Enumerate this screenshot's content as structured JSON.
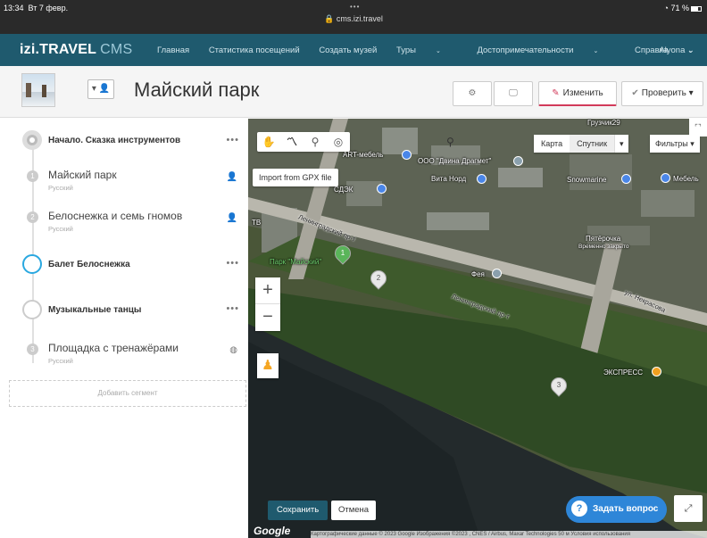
{
  "status": {
    "time": "13:34",
    "date": "Вт 7 февр.",
    "dots": "•••",
    "url": "cms.izi.travel",
    "battery": "71 %"
  },
  "nav": {
    "logo": "izi.TRAVEL",
    "logo_cms": "CMS",
    "items": [
      "Главная",
      "Статистика посещений",
      "Создать музей",
      "Туры",
      "Достопримечательности",
      "Справка"
    ],
    "user": "Alyona"
  },
  "header": {
    "title": "Майский парк",
    "edit_label": "Изменить",
    "check_label": "Проверить"
  },
  "sidebar": {
    "segments": [
      {
        "title": "Начало. Сказка инструментов"
      },
      {
        "title": "Балет Белоснежка"
      },
      {
        "title": "Музыкальные танцы"
      }
    ],
    "items": [
      {
        "num": "1",
        "title": "Майский парк",
        "lang": "Русский"
      },
      {
        "num": "2",
        "title": "Белоснежка и семь гномов",
        "lang": "Русский"
      },
      {
        "num": "3",
        "title": "Площадка с тренажёрами",
        "lang": "Русский"
      }
    ],
    "add_segment": "Добавить сегмент",
    "dots": "•••"
  },
  "map": {
    "gpx_import": "Import from GPX file",
    "map_type": "Карта",
    "satellite": "Спутник",
    "filters": "Фильтры",
    "save": "Сохранить",
    "cancel": "Отмена",
    "ask": "Задать вопрос",
    "google": "Google",
    "copyright": "Картографические данные © 2023 Google Изображения ©2023 , CNES / Airbus, Maxar Technologies  50 м  Условия использования",
    "labels": {
      "art": "ART-мебель",
      "dvina": "ООО \"Двина Драгмет\"",
      "vita": "Вита Норд",
      "sdek": "СДЭК",
      "gruzchik": "Грузчик29",
      "snowmarine": "Snowmarine",
      "mebel": "Мебель",
      "pyaterochka": "Пятёрочка",
      "closed": "Временно закрыто",
      "park": "Парк \"Майский\"",
      "feya": "Фея",
      "leningrad1": "Ленинградский пр-т",
      "leningrad2": "Ленинградский пр-т",
      "nekrasova": "ул. Некрасова",
      "ekspress": "ЭКСПРЕСС",
      "tb": "ТВ"
    },
    "markers": [
      "1",
      "2",
      "3"
    ]
  }
}
